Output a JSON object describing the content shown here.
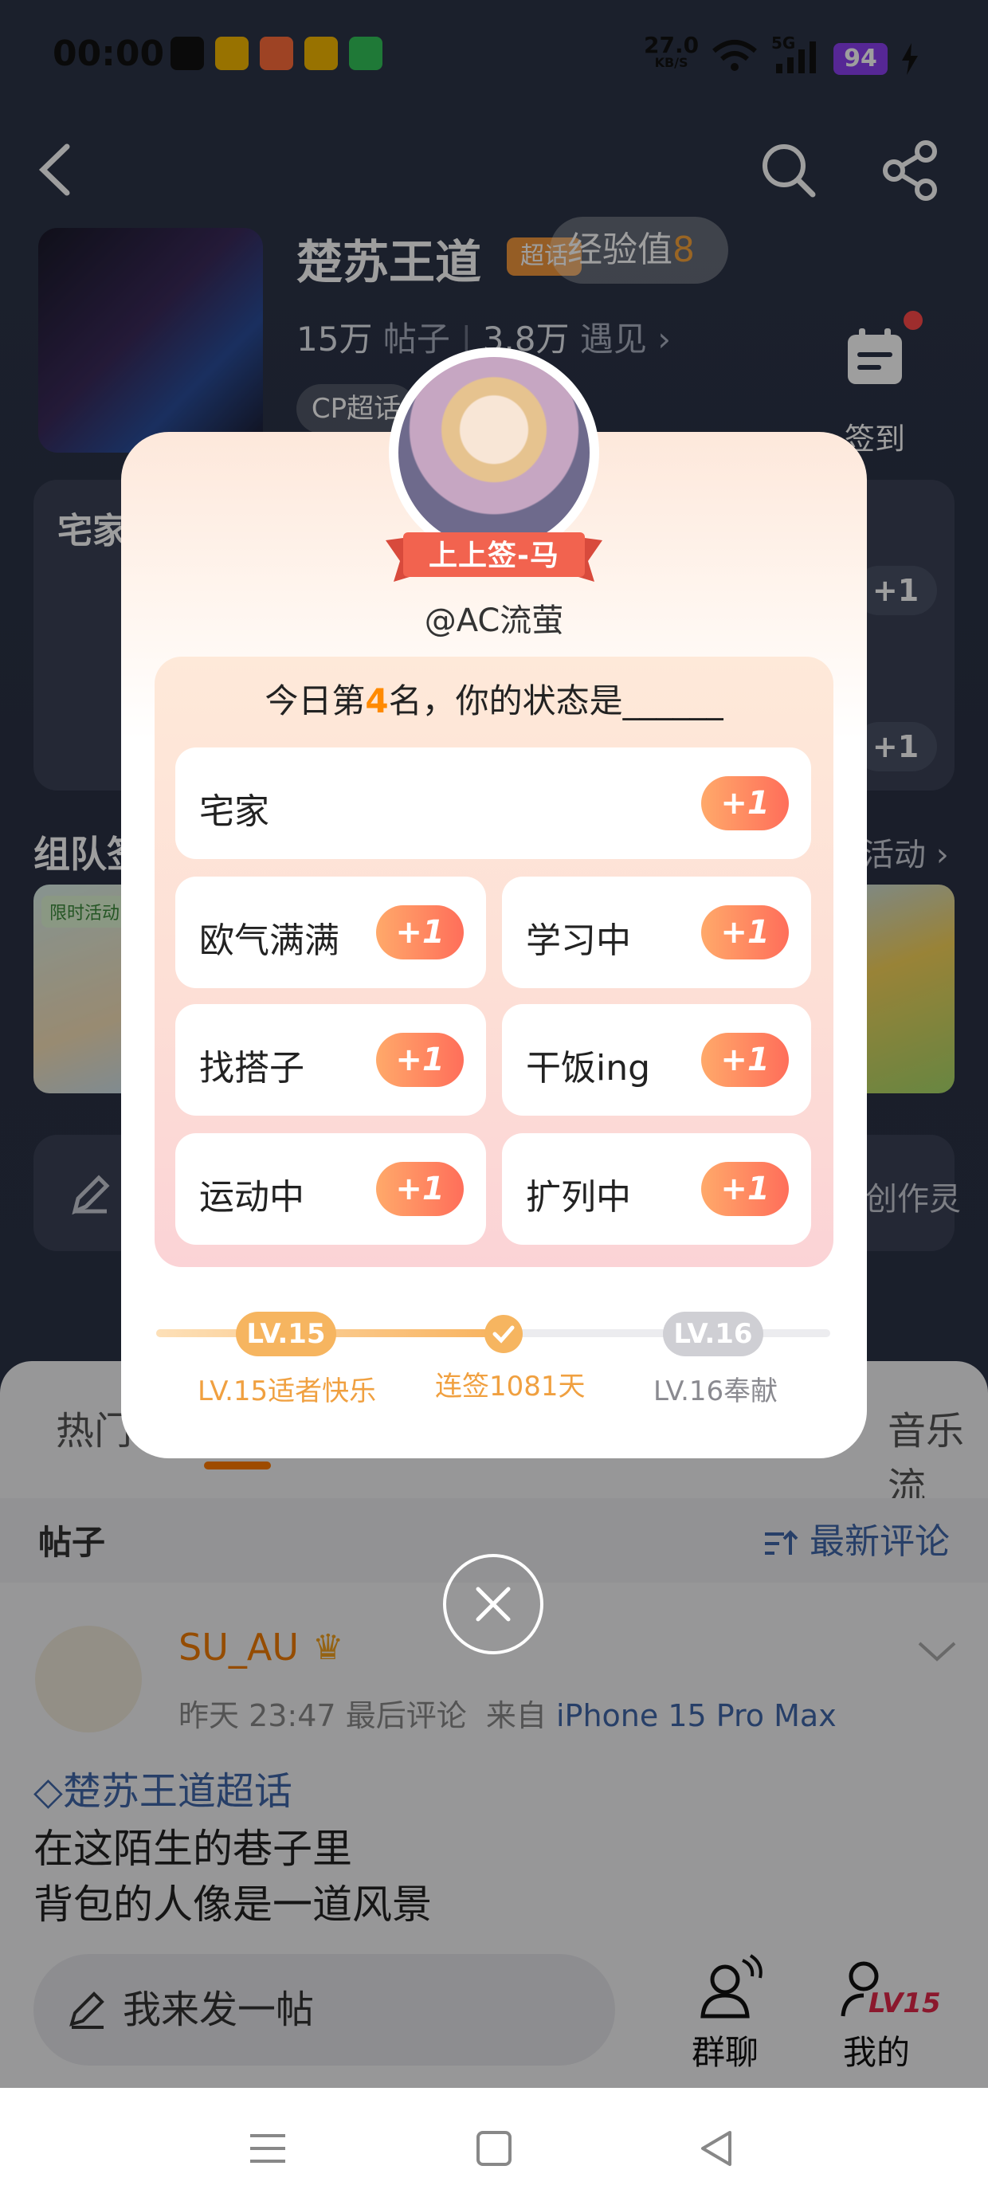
{
  "status_bar": {
    "time": "00:00",
    "net_speed": "27.0",
    "net_unit": "KB/S",
    "network": "5G",
    "battery": "94"
  },
  "topic": {
    "name": "楚苏王道",
    "tag": "超话",
    "exp_label": "经验值",
    "exp_value": "8",
    "posts_count": "15万",
    "posts_label": "帖子",
    "meet_count": "3.8万",
    "meet_label": "遇见",
    "cp_tag": "CP超话",
    "checkin_label": "签到"
  },
  "background": {
    "card_title": "宅家",
    "plus": "+1",
    "team_title": "组队签",
    "team_more": "活动",
    "activity_tag": "限时活动",
    "create_text": "创作灵",
    "tabs": [
      "热门",
      "音乐流"
    ]
  },
  "modal": {
    "ribbon": "上上签-马",
    "handle": "@AC流萤",
    "title_prefix": "今日第",
    "rank": "4",
    "title_suffix": "名，你的状态是______",
    "options": [
      {
        "label": "宅家",
        "plus": "+1"
      },
      {
        "label": "欧气满满",
        "plus": "+1"
      },
      {
        "label": "学习中",
        "plus": "+1"
      },
      {
        "label": "找搭子",
        "plus": "+1"
      },
      {
        "label": "干饭ing",
        "plus": "+1"
      },
      {
        "label": "运动中",
        "plus": "+1"
      },
      {
        "label": "扩列中",
        "plus": "+1"
      }
    ],
    "level_current": "LV.15",
    "level_next": "LV.16",
    "caption_current": "LV.15适者快乐",
    "caption_mid": "连签1081天",
    "caption_next": "LV.16奉献",
    "progress_fraction": 0.52
  },
  "feed": {
    "posts_label": "帖子",
    "sort_label": "最新评论",
    "post": {
      "user": "SU_AU",
      "time": "昨天 23:47",
      "time_suffix": "最后评论",
      "from_label": "来自",
      "device": "iPhone 15 Pro Max",
      "topic": "楚苏王道超话",
      "lines": [
        "在这陌生的巷子里",
        "背包的人像是一道风景"
      ]
    },
    "composer_placeholder": "我来发一帖",
    "group_label": "群聊",
    "mine_label": "我的",
    "mine_level": "LV15"
  },
  "colors": {
    "accent_orange": "#ff8a00",
    "plus_gradient_start": "#ffa96a",
    "plus_gradient_end": "#ff6e5a",
    "link_blue": "#3f66a8",
    "battery_purple": "#8b3ff0"
  }
}
